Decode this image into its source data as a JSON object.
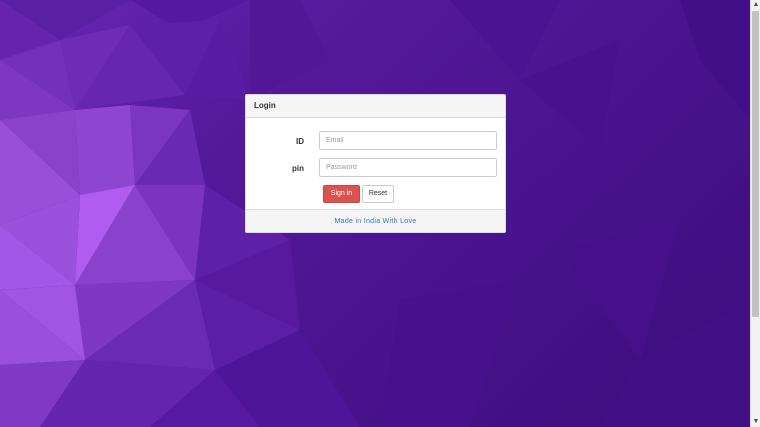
{
  "background": {
    "base_color": "#4a1590",
    "accent_color": "#b15cf0"
  },
  "login_panel": {
    "title": "Login",
    "id_label": "ID",
    "email_placeholder": "Email",
    "email_value": "",
    "pin_label": "pin",
    "password_placeholder": "Password",
    "password_value": "",
    "signin_label": "Sign in",
    "reset_label": "Reset",
    "footer_text": "Made in India With Love",
    "signin_color": "#d9534f",
    "link_color": "#337ab7"
  },
  "scrollbar": {
    "up_icon": "scroll-up-arrow-icon",
    "down_icon": "scroll-down-arrow-icon"
  }
}
